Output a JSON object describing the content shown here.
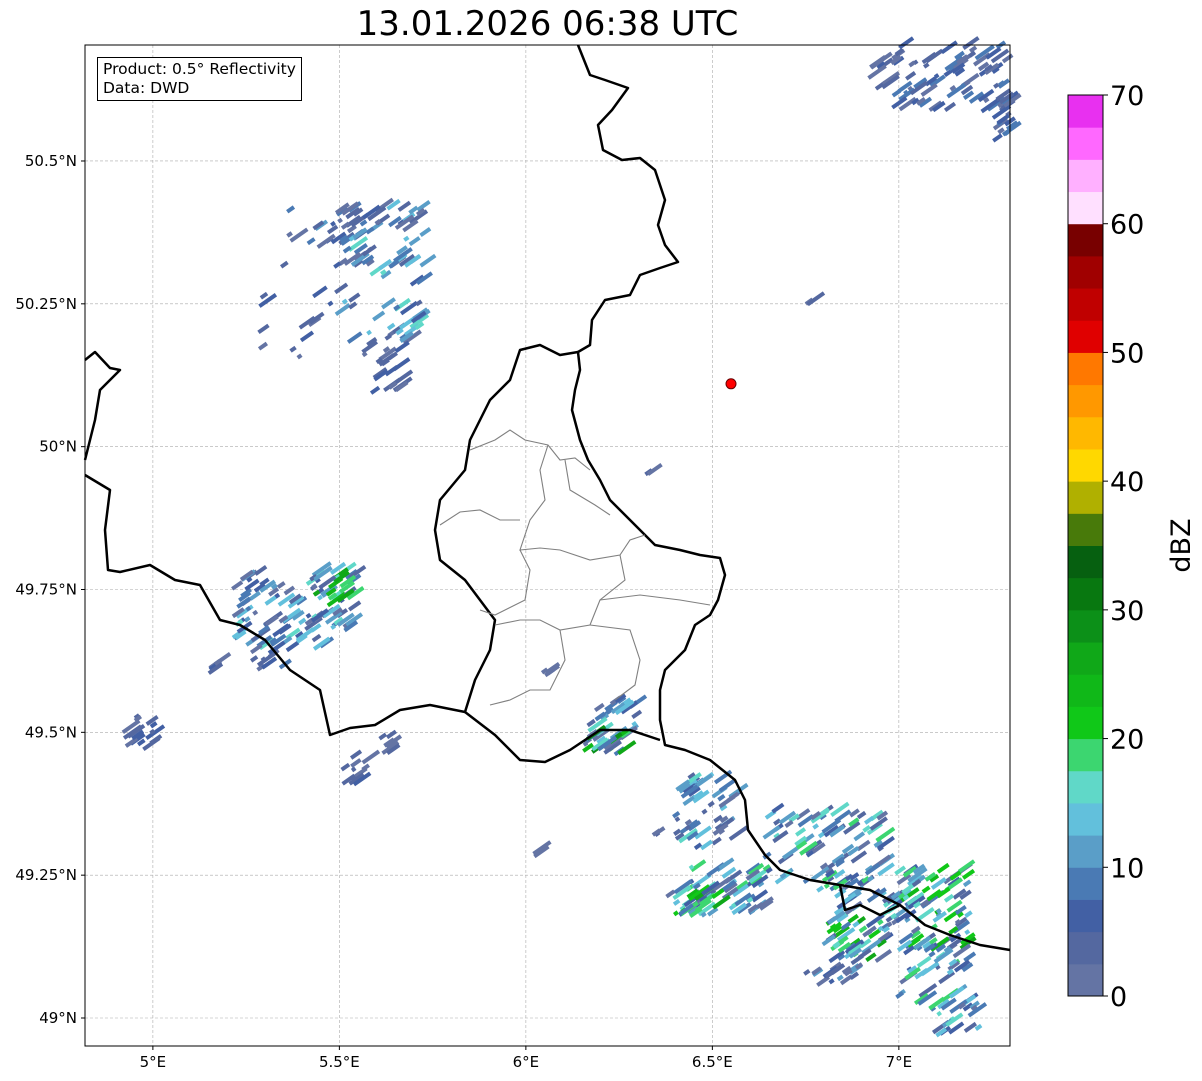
{
  "title": "13.01.2026 06:38 UTC",
  "info_box": {
    "product": "Product: 0.5° Reflectivity",
    "data": "Data: DWD"
  },
  "map": {
    "extent_lon": [
      4.818,
      7.298
    ],
    "extent_lat": [
      48.951,
      50.703
    ],
    "grid": true,
    "lon_ticks": [
      {
        "v": 5,
        "label": "5°E"
      },
      {
        "v": 5.5,
        "label": "5.5°E"
      },
      {
        "v": 6,
        "label": "6°E"
      },
      {
        "v": 6.5,
        "label": "6.5°E"
      },
      {
        "v": 7,
        "label": "7°E"
      }
    ],
    "lat_ticks": [
      {
        "v": 50.5,
        "label": "50.5°N"
      },
      {
        "v": 50.25,
        "label": "50.25°N"
      },
      {
        "v": 50,
        "label": "50°N"
      },
      {
        "v": 49.75,
        "label": "49.75°N"
      },
      {
        "v": 49.5,
        "label": "49.5°N"
      },
      {
        "v": 49.25,
        "label": "49.25°N"
      },
      {
        "v": 49,
        "label": "49°N"
      }
    ],
    "marker": {
      "lon": 6.55,
      "lat": 50.11,
      "color": "#ff0000"
    },
    "border_color": "#000000",
    "canton_color": "#808080"
  },
  "colorbar": {
    "label": "dBZ",
    "min": 0,
    "max": 70,
    "ticks": [
      0,
      10,
      20,
      30,
      40,
      50,
      60,
      70
    ],
    "colors": [
      "#6474a4",
      "#5468a0",
      "#4260a4",
      "#4a7ab4",
      "#5a9ec8",
      "#62c0dc",
      "#60d8c8",
      "#3cd670",
      "#10c818",
      "#10b818",
      "#10a818",
      "#0c9018",
      "#087810",
      "#066010",
      "#487a0a",
      "#b0b000",
      "#ffd800",
      "#ffb800",
      "#ff9800",
      "#ff7800",
      "#e00000",
      "#c00000",
      "#a00000",
      "#780000",
      "#ffe0ff",
      "#ffb0ff",
      "#ff68ff",
      "#e830f0"
    ]
  }
}
